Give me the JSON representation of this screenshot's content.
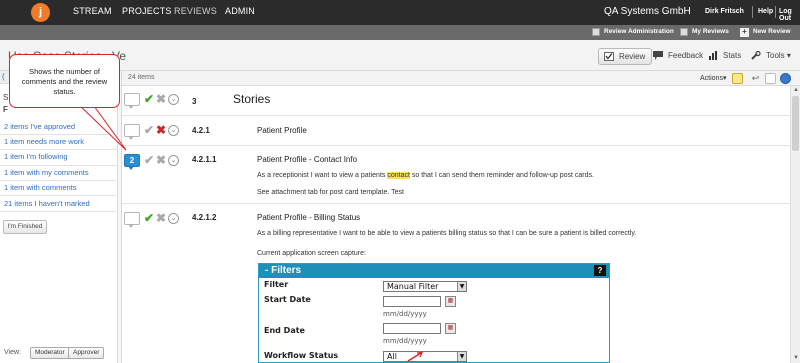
{
  "topnav": {
    "logo_letter": "j",
    "links": [
      "STREAM",
      "PROJECTS",
      "REVIEWS",
      "ADMIN"
    ],
    "company": "QA Systems GmbH",
    "user": "Dirk Fritsch",
    "help": "Help",
    "logout": "Log Out"
  },
  "subbar": {
    "review_admin": "Review Administration",
    "my_reviews": "My Reviews",
    "new_review": "New Review"
  },
  "titlestrip": {
    "title": "Use Case Stories - Ve",
    "buttons": {
      "review": "Review",
      "feedback": "Feedback",
      "stats": "Stats",
      "tools": "Tools ▾"
    }
  },
  "callout": {
    "text": "Shows the number of comments and the review status."
  },
  "leftpane": {
    "frag_s": "S",
    "frag_f": "F",
    "frag_paren": "(",
    "links": [
      "2 items I've approved",
      "1 item needs more work",
      "1 item I'm following",
      "1 item with my comments",
      "1 item with comments",
      "21 items I haven't marked"
    ],
    "finished": "I'm Finished",
    "view_label": "View:",
    "view_moderator": "Moderator",
    "view_approver": "Approver"
  },
  "main": {
    "items_count": "24 items",
    "actions": "Actions▾",
    "rows": [
      {
        "id": "3",
        "title": "Stories",
        "comments": "",
        "status": "approved"
      },
      {
        "id": "4.2.1",
        "title": "Patient Profile",
        "comments": "",
        "status": "rejected"
      },
      {
        "id": "4.2.1.1",
        "title": "Patient Profile - Contact Info",
        "comments": "2",
        "status": "none",
        "text1_a": "As a receptionist I want to view a patients ",
        "text1_hl": "contact",
        "text1_b": " so that I can send them reminder and follow-up post cards.",
        "text2": "See attachment tab for post card template. Test"
      },
      {
        "id": "4.2.1.2",
        "title": "Patient Profile - Billing Status",
        "comments": "",
        "status": "approved",
        "text1": "As a billing representative I want to be able to view a patients billing status so that I can be sure a patient is billed correctly.",
        "text2": "Current application screen capture:"
      }
    ]
  },
  "filters": {
    "header": "- Filters",
    "help": "?",
    "filter_label": "Filter",
    "filter_value": "Manual Filter",
    "start_label": "Start Date",
    "end_label": "End Date",
    "date_hint": "mm/dd/yyyy",
    "workflow_label": "Workflow Status",
    "workflow_value": "All"
  },
  "colors": {
    "accent": "#1d8fb8",
    "approve": "#43a52a",
    "reject": "#d0282a",
    "comment_badge": "#2b8fd6",
    "logo": "#f07b2a"
  }
}
